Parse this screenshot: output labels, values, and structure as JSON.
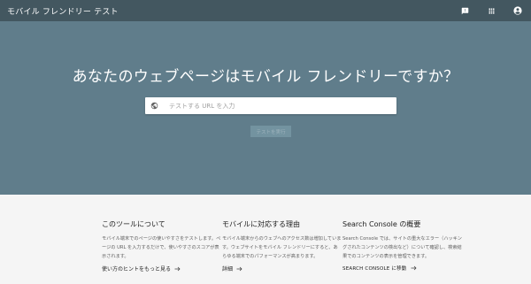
{
  "header": {
    "title": "モバイル フレンドリー テスト",
    "icons": [
      "feedback-icon",
      "apps-grid-icon",
      "account-icon"
    ]
  },
  "hero": {
    "heading": "あなたのウェブページはモバイル フレンドリーですか？",
    "url_input": {
      "value": "",
      "placeholder": "テストする URL を入力"
    },
    "test_button": "テストを実行",
    "colors": {
      "background": "#607d8b",
      "topbar": "#435760"
    }
  },
  "sections": [
    {
      "title": "このツールについて",
      "body": "モバイル端末でのページの使いやすさをテストします。ページの URL を入力するだけで、使いやすさのスコアが表示されます。",
      "link": "使い方のヒントをもっと見る"
    },
    {
      "title": "モバイルに対応する理由",
      "body": "モバイル端末からのウェブへのアクセス数は増加しています。ウェブサイトをモバイル フレンドリーにすると、あらゆる端末でのパフォーマンスが高まります。",
      "link": "詳細"
    },
    {
      "title": "Search Console の概要",
      "body": "Search Console では、サイトの重大なエラー（ハッキングされたコンテンツの検出など）について確認し、検索結果でのコンテンツの表示を管理できます。",
      "link": "SEARCH CONSOLE に移動"
    }
  ]
}
